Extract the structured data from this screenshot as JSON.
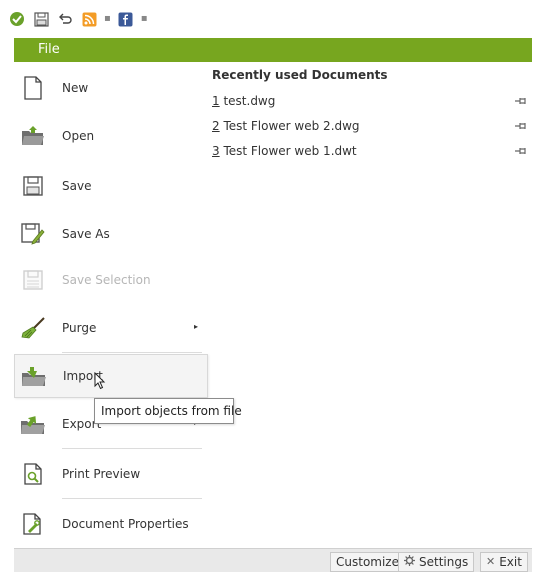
{
  "file_tab": {
    "label": "File"
  },
  "menu": {
    "new": "New",
    "open": "Open",
    "save": "Save",
    "save_as": "Save As",
    "save_selection": "Save Selection",
    "purge": "Purge",
    "import": "Import",
    "export": "Export",
    "print_preview": "Print Preview",
    "document_properties": "Document Properties"
  },
  "recent": {
    "title": "Recently used Documents",
    "items": [
      {
        "num": "1",
        "name": " test.dwg"
      },
      {
        "num": "2",
        "name": " Test Flower web 2.dwg"
      },
      {
        "num": "3",
        "name": " Test Flower web 1.dwt"
      }
    ]
  },
  "tooltip": {
    "text": "Import objects from file"
  },
  "footer": {
    "customize": "Customize",
    "settings": "Settings",
    "exit": "Exit"
  },
  "colors": {
    "accent": "#77a61f",
    "tooltip_border": "#8c8c8c"
  }
}
